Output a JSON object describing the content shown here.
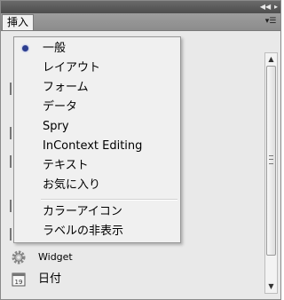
{
  "panel": {
    "tab_label": "挿入",
    "collapse_icon": "double-left-arrow-icon",
    "close_icon": "double-right-arrow-icon",
    "menu_icon": "panel-menu-icon"
  },
  "dropdown": {
    "items": [
      {
        "label": "一般",
        "selected": true
      },
      {
        "label": "レイアウト",
        "selected": false
      },
      {
        "label": "フォーム",
        "selected": false
      },
      {
        "label": "データ",
        "selected": false
      },
      {
        "label": "Spry",
        "selected": false
      },
      {
        "label": "InContext Editing",
        "selected": false
      },
      {
        "label": "テキスト",
        "selected": false
      },
      {
        "label": "お気に入り",
        "selected": false
      }
    ],
    "option_items": [
      {
        "label": "カラーアイコン"
      },
      {
        "label": "ラベルの非表示"
      }
    ]
  },
  "insert_items": [
    {
      "label": "Widget",
      "icon": "gear-icon"
    },
    {
      "label": "日付",
      "icon": "calendar-icon"
    }
  ],
  "colors": {
    "panel_bg": "#e9e9e9",
    "titlebar": "#4d4d4d",
    "tabstrip": "#8c8c8c",
    "menu_bg": "#f0f0f0",
    "radio": "#2c3e8f"
  }
}
